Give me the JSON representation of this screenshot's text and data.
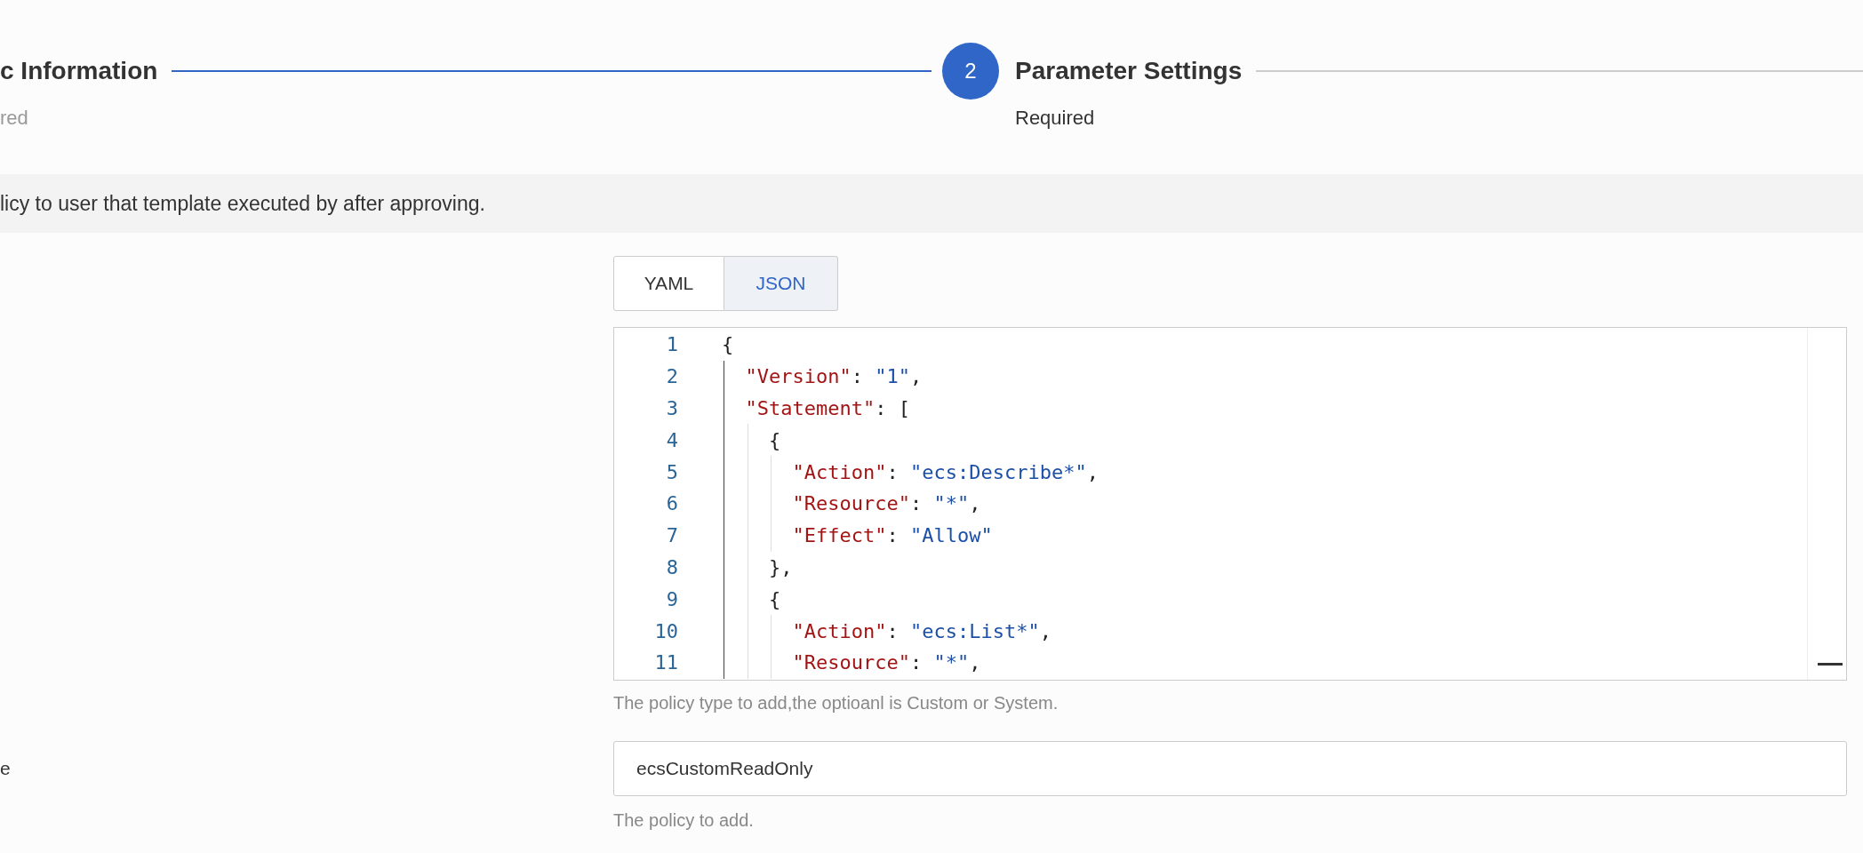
{
  "steps": [
    {
      "title": "c Information",
      "subtitle": "red",
      "selected": false
    },
    {
      "number": "2",
      "title": "Parameter Settings",
      "subtitle": "Required",
      "selected": true
    }
  ],
  "notice": "licy to user that template executed by after approving.",
  "policy_document": {
    "tabs": [
      {
        "label": "YAML",
        "selected": false
      },
      {
        "label": "JSON",
        "selected": true
      }
    ],
    "lines": [
      {
        "number": "1",
        "tokens": [
          {
            "kind": "punct",
            "text": "{"
          }
        ],
        "children": [
          {
            "number": "2",
            "tokens": [
              {
                "kind": "key",
                "text": "\"Version\""
              },
              {
                "kind": "punct",
                "text": ": "
              },
              {
                "kind": "string",
                "text": "\"1\""
              },
              {
                "kind": "punct",
                "text": ","
              }
            ]
          },
          {
            "number": "3",
            "tokens": [
              {
                "kind": "key",
                "text": "\"Statement\""
              },
              {
                "kind": "punct",
                "text": ": ["
              }
            ],
            "children": [
              {
                "number": "4",
                "tokens": [
                  {
                    "kind": "punct",
                    "text": "{"
                  }
                ],
                "children": [
                  {
                    "number": "5",
                    "tokens": [
                      {
                        "kind": "key",
                        "text": "\"Action\""
                      },
                      {
                        "kind": "punct",
                        "text": ": "
                      },
                      {
                        "kind": "string",
                        "text": "\"ecs:Describe*\""
                      },
                      {
                        "kind": "punct",
                        "text": ","
                      }
                    ]
                  },
                  {
                    "number": "6",
                    "tokens": [
                      {
                        "kind": "key",
                        "text": "\"Resource\""
                      },
                      {
                        "kind": "punct",
                        "text": ": "
                      },
                      {
                        "kind": "string",
                        "text": "\"*\""
                      },
                      {
                        "kind": "punct",
                        "text": ","
                      }
                    ]
                  },
                  {
                    "number": "7",
                    "tokens": [
                      {
                        "kind": "key",
                        "text": "\"Effect\""
                      },
                      {
                        "kind": "punct",
                        "text": ": "
                      },
                      {
                        "kind": "string",
                        "text": "\"Allow\""
                      }
                    ]
                  }
                ]
              },
              {
                "number": "8",
                "tokens": [
                  {
                    "kind": "punct",
                    "text": "},"
                  }
                ]
              },
              {
                "number": "9",
                "tokens": [
                  {
                    "kind": "punct",
                    "text": "{"
                  }
                ],
                "children": [
                  {
                    "number": "10",
                    "tokens": [
                      {
                        "kind": "key",
                        "text": "\"Action\""
                      },
                      {
                        "kind": "punct",
                        "text": ": "
                      },
                      {
                        "kind": "string",
                        "text": "\"ecs:List*\""
                      },
                      {
                        "kind": "punct",
                        "text": ","
                      }
                    ]
                  },
                  {
                    "number": "11",
                    "tokens": [
                      {
                        "kind": "key",
                        "text": "\"Resource\""
                      },
                      {
                        "kind": "punct",
                        "text": ": "
                      },
                      {
                        "kind": "string",
                        "text": "\"*\""
                      },
                      {
                        "kind": "punct",
                        "text": ","
                      }
                    ]
                  }
                ]
              }
            ]
          }
        ]
      }
    ],
    "hint": "The policy type to add,the optioanl is Custom or System."
  },
  "policy_name": {
    "label": "e",
    "value": "ecsCustomReadOnly",
    "hint": "The policy to add."
  }
}
